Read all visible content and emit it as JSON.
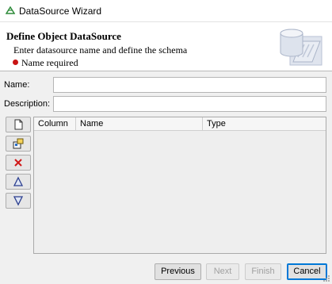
{
  "window": {
    "title": "DataSource Wizard"
  },
  "banner": {
    "heading": "Define Object DataSource",
    "description": "Enter datasource name and define the schema",
    "error_text": "Name required",
    "error_color": "#c81414"
  },
  "form": {
    "name_label": "Name:",
    "name_value": "",
    "description_label": "Description:",
    "description_value": ""
  },
  "toolbar": {
    "buttons": [
      {
        "icon": "new-document-icon"
      },
      {
        "icon": "import-class-icon"
      },
      {
        "icon": "delete-icon"
      },
      {
        "icon": "move-up-icon"
      },
      {
        "icon": "move-down-icon"
      }
    ]
  },
  "grid": {
    "columns": [
      "Column",
      "Name",
      "Type"
    ],
    "rows": []
  },
  "footer": {
    "previous_label": "Previous",
    "next_label": "Next",
    "finish_label": "Finish",
    "cancel_label": "Cancel"
  },
  "colors": {
    "accent": "#0078d7",
    "error": "#c81414"
  }
}
